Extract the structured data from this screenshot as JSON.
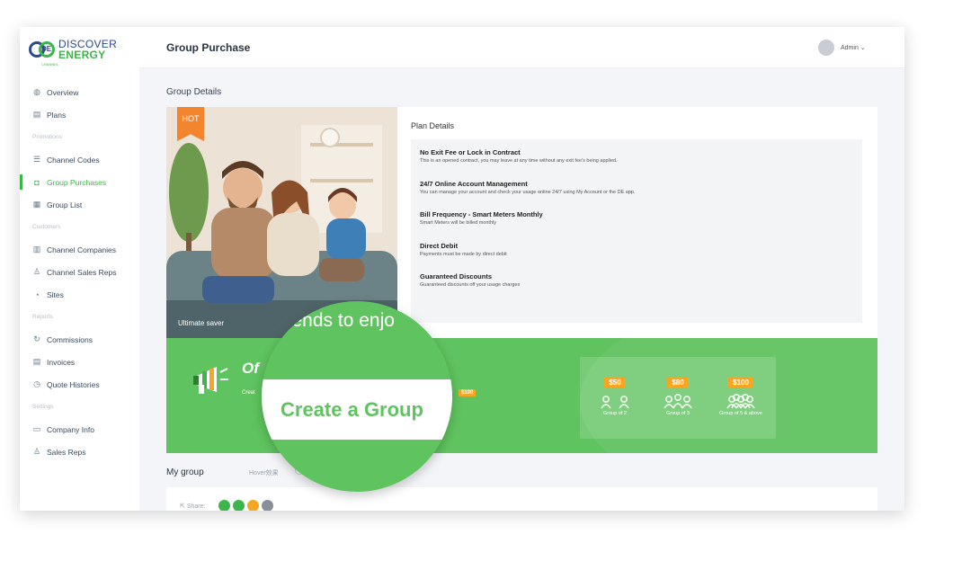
{
  "brand": {
    "line1": "DISCOVER",
    "line2": "ENERGY",
    "tagline": "CHANNEL",
    "mark": "DE"
  },
  "header": {
    "title": "Group Purchase",
    "user": "Admin ⌄"
  },
  "sidebar": {
    "items": [
      {
        "type": "item",
        "label": "Overview",
        "icon": "gauge-icon",
        "glyph": "◍"
      },
      {
        "type": "item",
        "label": "Plans",
        "icon": "document-icon",
        "glyph": "▤"
      },
      {
        "type": "section",
        "label": "Promotions"
      },
      {
        "type": "item",
        "label": "Channel Codes",
        "icon": "list-icon",
        "glyph": "☰"
      },
      {
        "type": "item",
        "label": "Group Purchases",
        "icon": "bag-icon",
        "glyph": "◘",
        "active": true
      },
      {
        "type": "item",
        "label": "Group List",
        "icon": "grid-icon",
        "glyph": "▦"
      },
      {
        "type": "section",
        "label": "Customers"
      },
      {
        "type": "item",
        "label": "Channel Companies",
        "icon": "building-icon",
        "glyph": "▥"
      },
      {
        "type": "item",
        "label": "Channel Sales Reps",
        "icon": "person-icon",
        "glyph": "♙"
      },
      {
        "type": "item",
        "label": "Sites",
        "icon": "wifi-icon",
        "glyph": "◔"
      },
      {
        "type": "section",
        "label": "Reports"
      },
      {
        "type": "item",
        "label": "Commissions",
        "icon": "refresh-icon",
        "glyph": "↻"
      },
      {
        "type": "item",
        "label": "Invoices",
        "icon": "invoice-icon",
        "glyph": "▤"
      },
      {
        "type": "item",
        "label": "Quote Histories",
        "icon": "history-icon",
        "glyph": "◷"
      },
      {
        "type": "section",
        "label": "Settings"
      },
      {
        "type": "item",
        "label": "Company Info",
        "icon": "id-card-icon",
        "glyph": "▭"
      },
      {
        "type": "item",
        "label": "Sales Reps",
        "icon": "person-icon",
        "glyph": "♙"
      }
    ]
  },
  "main": {
    "section_title": "Group Details",
    "hot_badge": "HOT",
    "photo_caption": "Ultimate saver",
    "plan_title": "Plan Details",
    "plan_details": [
      {
        "heading": "No Exit Fee or Lock in Contract",
        "desc": "This is an opened contract, you may leave at any time without any exit fee's being applied."
      },
      {
        "heading": "24/7 Online Account Management",
        "desc": "You can manage your account and check your usage online 24/7 using My Account or the DE app."
      },
      {
        "heading": "Bill Frequency - Smart Meters Monthly",
        "desc": "Smart Meters will be billed monthly"
      },
      {
        "heading": "Direct Debit",
        "desc": "Payments must be made by direct debit"
      },
      {
        "heading": "Guaranteed Discounts",
        "desc": "Guaranteed discounts off your usage charges"
      }
    ],
    "banner": {
      "offer_text": "Of",
      "sub_text": "Creat",
      "pill": "$100",
      "tiers": [
        {
          "price": "$50",
          "label": "Group of 2",
          "people": 2
        },
        {
          "price": "$80",
          "label": "Group of 3",
          "people": 3
        },
        {
          "price": "$100",
          "label": "Group of 5 & above",
          "people": 5
        }
      ]
    },
    "magnifier": {
      "headline": "friends to enjo",
      "button": "Create a Group"
    },
    "my_group": {
      "title": "My group",
      "hover_hint": "Hover效果",
      "share_label": "Share:"
    },
    "share_icons": [
      {
        "name": "share-green-icon",
        "color": "#3cb54a"
      },
      {
        "name": "share-green-2-icon",
        "color": "#3cb54a"
      },
      {
        "name": "share-orange-icon",
        "color": "#f5a623"
      },
      {
        "name": "share-grey-icon",
        "color": "#8a9099"
      }
    ]
  },
  "colors": {
    "accent": "#3cb54a",
    "banner": "#5fc35f",
    "badge": "#f5a623",
    "hot": "#f2852e",
    "brand_blue": "#2f4a8a"
  }
}
